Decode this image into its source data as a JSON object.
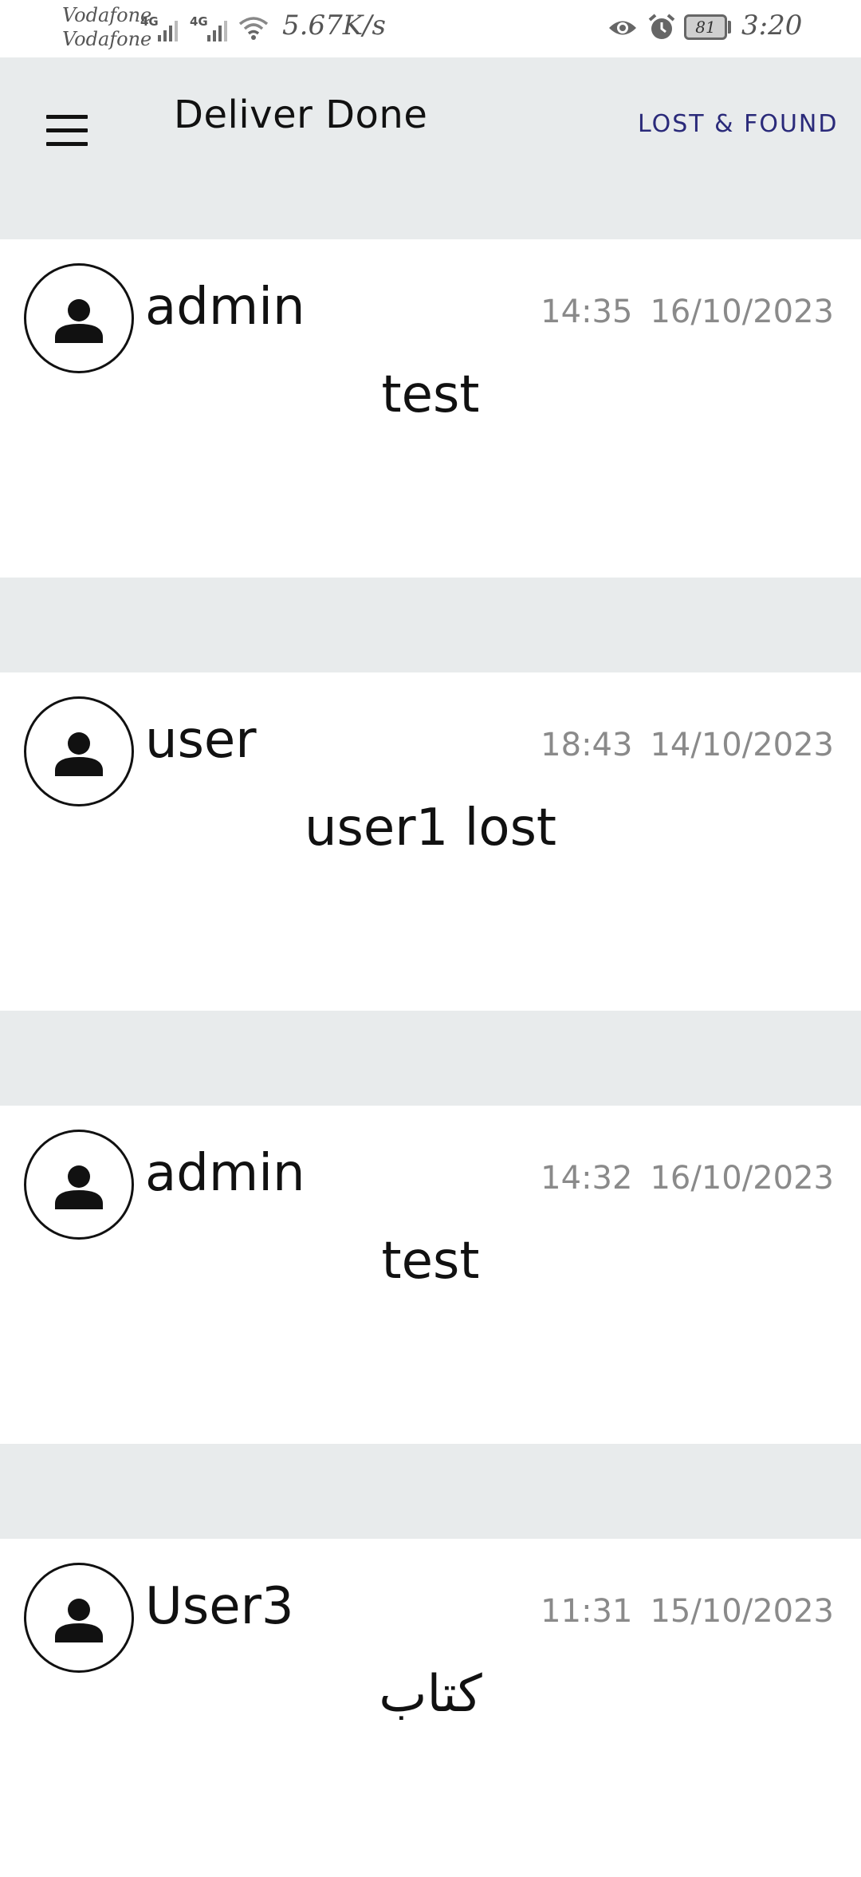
{
  "status_bar": {
    "carrier_1": "Vodafone",
    "carrier_2": "Vodafone",
    "network_type_1": "4G",
    "network_type_2": "4G",
    "net_speed": "5.67K/s",
    "battery_level": "81",
    "time": "3:20",
    "icons": [
      "signal-icon",
      "signal-icon",
      "wifi-icon",
      "eye-icon",
      "alarm-icon",
      "battery-icon"
    ]
  },
  "app_bar": {
    "title": "Deliver Done",
    "action_label": "LOST & FOUND",
    "menu_icon": "hamburger-menu-icon",
    "background": "#e8ebec"
  },
  "posts": [
    {
      "author": "admin",
      "time": "14:35",
      "date": "16/10/2023",
      "message": "test",
      "avatar_icon": "person-icon"
    },
    {
      "author": "user",
      "time": "18:43",
      "date": "14/10/2023",
      "message": "user1 lost",
      "avatar_icon": "person-icon"
    },
    {
      "author": "admin",
      "time": "14:32",
      "date": "16/10/2023",
      "message": "test",
      "avatar_icon": "person-icon"
    },
    {
      "author": "User3",
      "time": "11:31",
      "date": "15/10/2023",
      "message": "كتاب",
      "avatar_icon": "person-icon"
    }
  ],
  "colors": {
    "accent": "#2a2a7a",
    "timestamp": "#8a8a8a",
    "text": "#111111"
  }
}
